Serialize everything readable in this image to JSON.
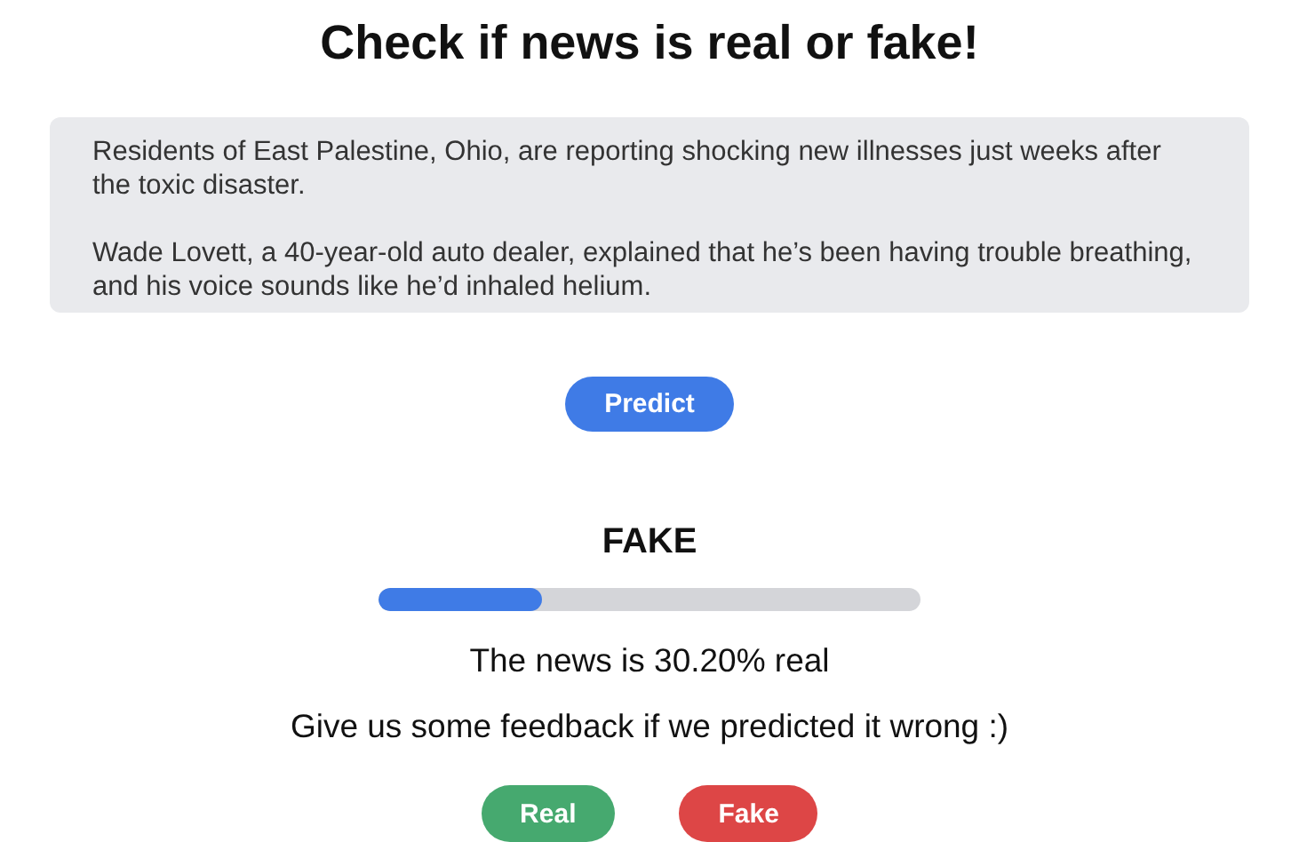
{
  "title": "Check if news is real or fake!",
  "article": {
    "value": "Residents of East Palestine, Ohio, are reporting shocking new illnesses just weeks after the toxic disaster.\n\nWade Lovett, a 40-year-old auto dealer, explained that he’s been having trouble breathing, and his voice sounds like he’d inhaled helium."
  },
  "predict_button": "Predict",
  "result": {
    "label": "FAKE",
    "level": 0.302,
    "summary": "The news is 30.20% real"
  },
  "feedback_prompt": "Give us some feedback if we predicted it wrong :)",
  "feedback_buttons": [
    {
      "label": "Real",
      "kind": "real"
    },
    {
      "label": "Fake",
      "kind": "fake"
    }
  ]
}
